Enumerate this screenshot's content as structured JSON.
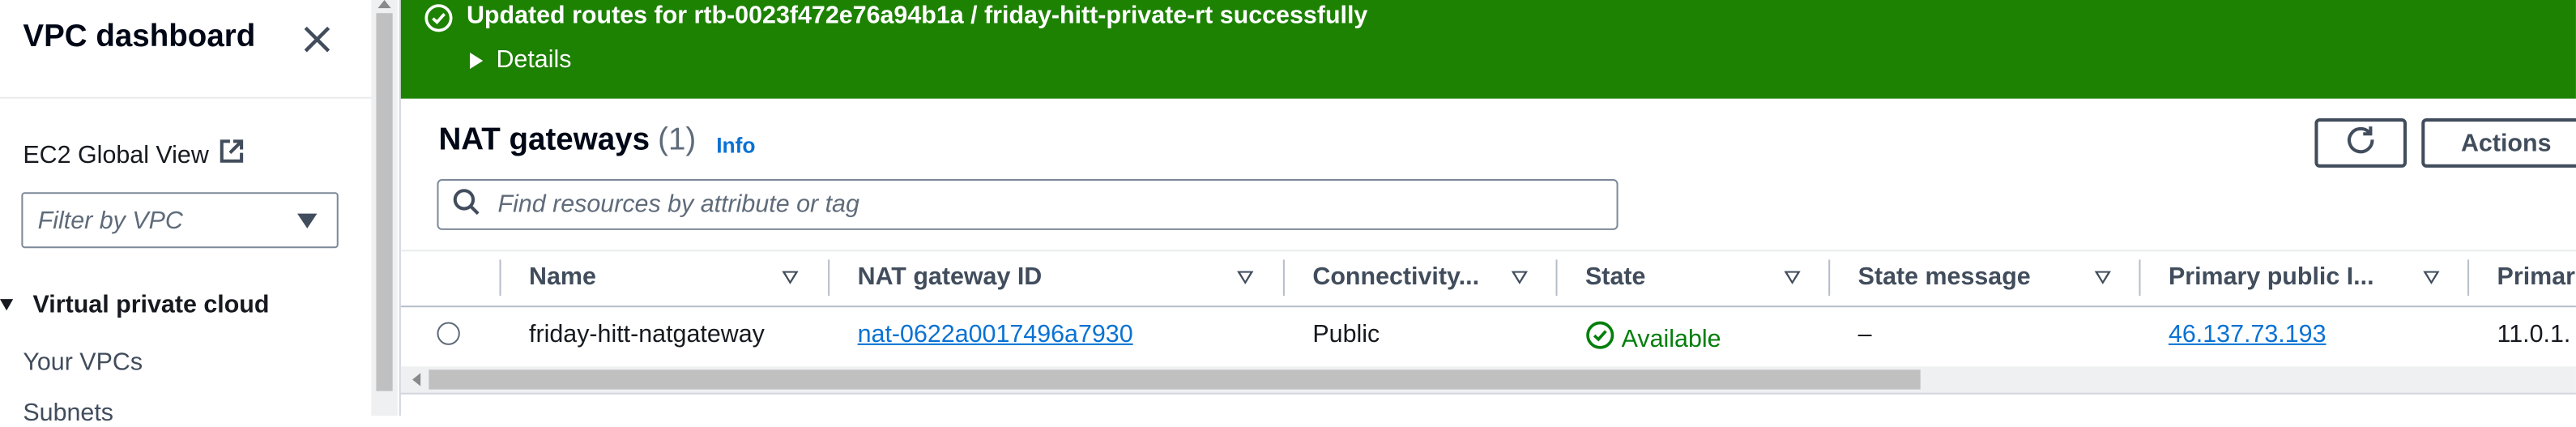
{
  "sidebar": {
    "title": "VPC dashboard",
    "ec2_global_view": "EC2 Global View",
    "filter_placeholder": "Filter by VPC",
    "section": "Virtual private cloud",
    "items": [
      {
        "label": "Your VPCs"
      },
      {
        "label": "Subnets"
      }
    ]
  },
  "flash": {
    "message": "Updated routes for rtb-0023f472e76a94b1a / friday-hitt-private-rt successfully",
    "details": "Details",
    "color": "#1d8102"
  },
  "header": {
    "title": "NAT gateways",
    "count": "(1)",
    "info": "Info",
    "actions_label": "Actions",
    "search_placeholder": "Find resources by attribute or tag"
  },
  "table": {
    "columns": [
      "Name",
      "NAT gateway ID",
      "Connectivity...",
      "State",
      "State message",
      "Primary public I...",
      "Primar"
    ],
    "rows": [
      {
        "name": "friday-hitt-natgateway",
        "nat_gateway_id": "nat-0622a0017496a7930",
        "connectivity": "Public",
        "state": "Available",
        "state_message": "–",
        "primary_public_ip": "46.137.73.193",
        "primary_private_ip": "11.0.1."
      }
    ]
  },
  "colors": {
    "link": "#0972d3",
    "success": "#037f0c"
  }
}
